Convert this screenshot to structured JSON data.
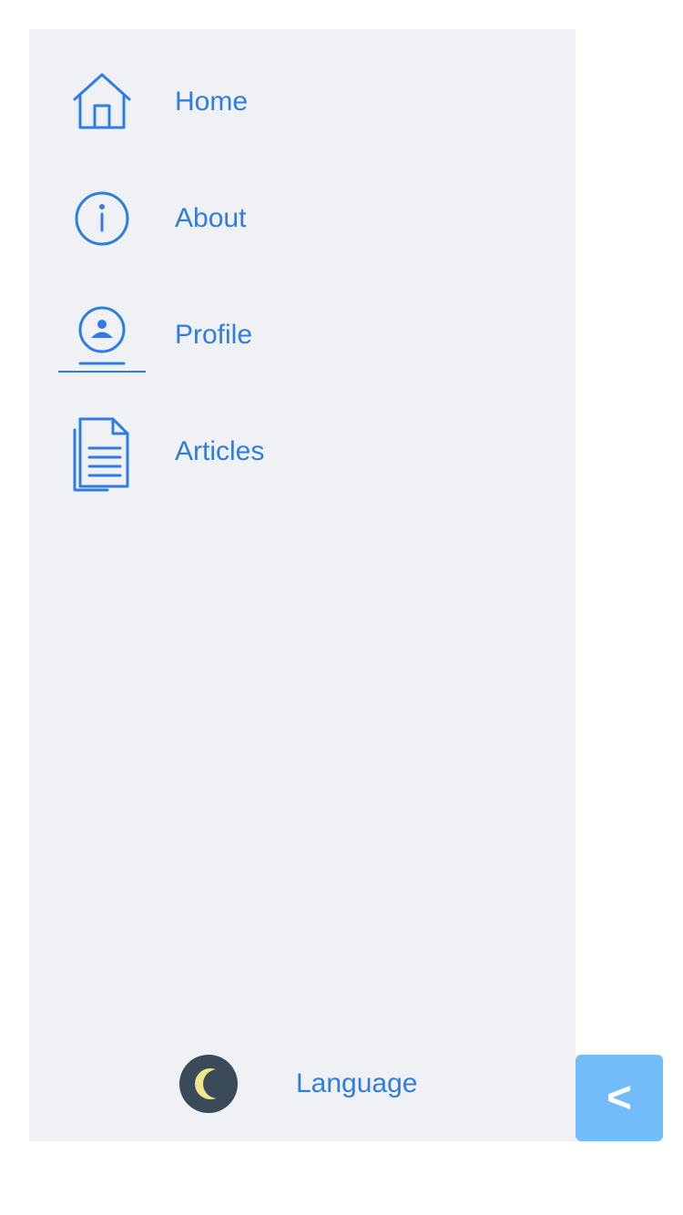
{
  "nav": {
    "items": [
      {
        "label": "Home",
        "icon": "home-icon"
      },
      {
        "label": "About",
        "icon": "info-icon"
      },
      {
        "label": "Profile",
        "icon": "profile-icon",
        "active": true
      },
      {
        "label": "Articles",
        "icon": "articles-icon"
      }
    ]
  },
  "footer": {
    "theme_icon": "moon-icon",
    "language_label": "Language"
  },
  "collapse_button": {
    "label": "<"
  },
  "colors": {
    "accent": "#2f7de1",
    "drawer_background": "#eff1f5",
    "toggle_background": "#3a4a5a",
    "moon": "#f3e58c",
    "collapse_button": "#73bcfa"
  }
}
